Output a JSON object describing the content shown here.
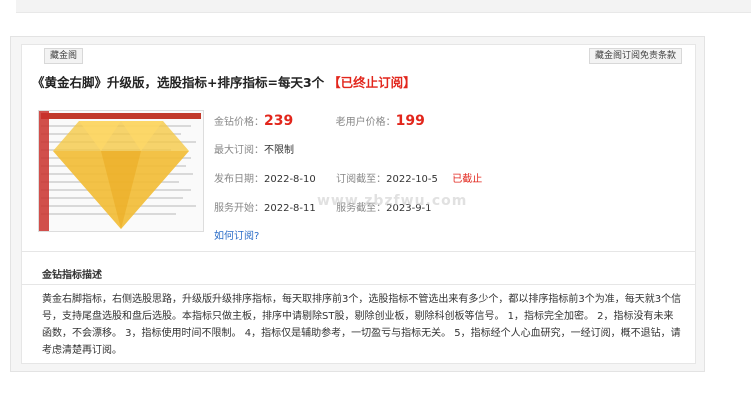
{
  "tabs": {
    "left": "藏金阁",
    "right": "藏金阁订阅免责条款"
  },
  "title": {
    "main": "《黄金右脚》升级版，选股指标+排序指标=每天3个",
    "status": "【已终止订阅】"
  },
  "pricing": {
    "gold_label": "金钻价格：",
    "gold_value": "239",
    "old_label": "老用户价格：",
    "old_value": "199"
  },
  "max_sub": {
    "label": "最大订阅：",
    "value": "不限制"
  },
  "dates": {
    "release_label": "发布日期：",
    "release_value": "2022-8-10",
    "deadline_label": "订阅截至：",
    "deadline_value": "2022-10-5",
    "deadline_status": "已截止",
    "service_start_label": "服务开始：",
    "service_start_value": "2022-8-11",
    "service_end_label": "服务截至：",
    "service_end_value": "2023-9-1"
  },
  "how_to_link": "如何订阅?",
  "watermark": "www.zbzfwu.com",
  "section_title": "金钻指标描述",
  "description": "黄金右脚指标，右侧选股思路，升级版升级排序指标，每天取排序前3个，选股指标不管选出来有多少个，都以排序指标前3个为准，每天就3个信号，支持尾盘选股和盘后选股。本指标只做主板，排序中请剔除ST股，剔除创业板，剔除科创板等信号。 1，指标完全加密。 2，指标没有未来函数，不会漂移。 3，指标使用时间不限制。 4，指标仅是辅助参考，一切盈亏与指标无关。 5，指标经个人心血研究，一经订阅，概不退钻，请考虑清楚再订阅。",
  "colors": {
    "accent_red": "#e2261c",
    "link_blue": "#2a6cc7",
    "diamond_yellow": "#f5c842"
  }
}
